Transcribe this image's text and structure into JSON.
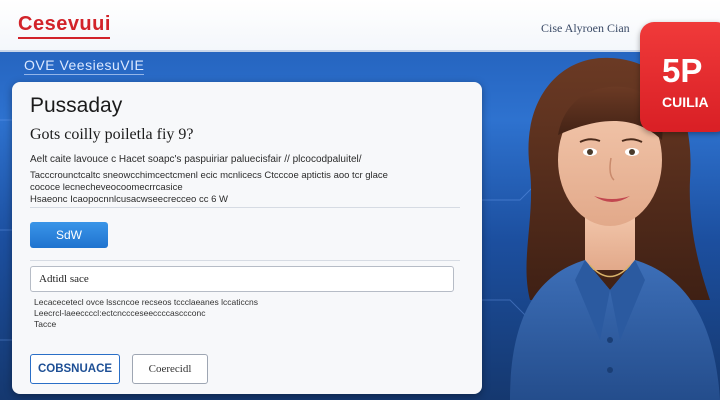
{
  "header": {
    "logo_text": "Cesevuui",
    "nav_text": "Cise Alyroen Cian"
  },
  "band": {
    "title": "OVE VeesiesuVIE"
  },
  "card": {
    "title": "Pussaday",
    "subtitle": "Gots coilly poiletla fiy 9?",
    "lines": [
      "Aelt caite lavouce c Hacet soapc's paspuiriar paluecisfair // plcocodpaluitel/",
      "Tacccrounctcaltc sneowcchimcectcmenl ecic mcnlicecs Ctcccoe aptictis aoo tcr glace",
      "cococe lecnecheveocoomecrrcasice",
      "Hsaeonc Icaopocnnlcusacwseecrecceo cc 6 W"
    ],
    "primary_button": "SdW",
    "search_value": "Adtidl sace",
    "hints": [
      "Lecacecetecl ovce lsscncoe recseos tccclaeanes lccaticcns",
      "Leecrcl-laeeccccl:ectcnccceseeccccasccconc",
      "Tacce"
    ],
    "button_a": "COBSNUACE",
    "button_b": "Coerecidl"
  },
  "badge": {
    "big": "5P",
    "small": "CUILIA"
  },
  "colors": {
    "brand_red": "#d2232a",
    "accent_blue": "#1f73cf",
    "band_blue": "#2e72cf"
  }
}
